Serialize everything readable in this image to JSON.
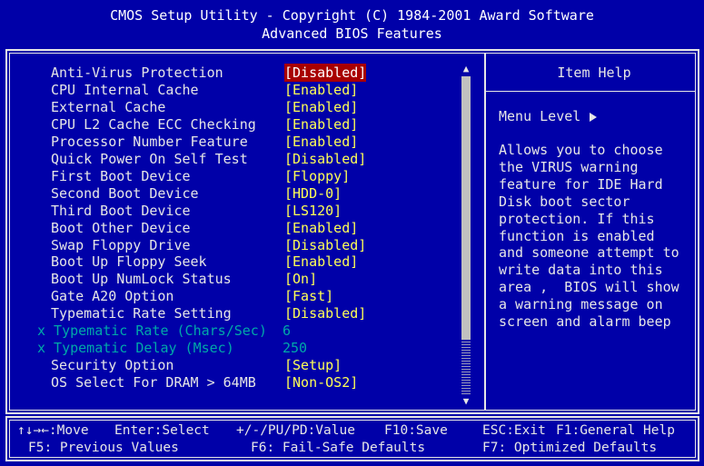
{
  "header": {
    "line1": "CMOS Setup Utility - Copyright (C) 1984-2001 Award Software",
    "line2": "Advanced BIOS Features"
  },
  "settings": [
    {
      "label": "Anti-Virus Protection",
      "value": "[Disabled]",
      "selected": true,
      "disabled": false
    },
    {
      "label": "CPU Internal Cache",
      "value": "[Enabled]",
      "selected": false,
      "disabled": false
    },
    {
      "label": "External Cache",
      "value": "[Enabled]",
      "selected": false,
      "disabled": false
    },
    {
      "label": "CPU L2 Cache ECC Checking",
      "value": "[Enabled]",
      "selected": false,
      "disabled": false
    },
    {
      "label": "Processor Number Feature",
      "value": "[Enabled]",
      "selected": false,
      "disabled": false
    },
    {
      "label": "Quick Power On Self Test",
      "value": "[Disabled]",
      "selected": false,
      "disabled": false
    },
    {
      "label": "First Boot Device",
      "value": "[Floppy]",
      "selected": false,
      "disabled": false
    },
    {
      "label": "Second Boot Device",
      "value": "[HDD-0]",
      "selected": false,
      "disabled": false
    },
    {
      "label": "Third Boot Device",
      "value": "[LS120]",
      "selected": false,
      "disabled": false
    },
    {
      "label": "Boot Other Device",
      "value": "[Enabled]",
      "selected": false,
      "disabled": false
    },
    {
      "label": "Swap Floppy Drive",
      "value": "[Disabled]",
      "selected": false,
      "disabled": false
    },
    {
      "label": "Boot Up Floppy Seek",
      "value": "[Enabled]",
      "selected": false,
      "disabled": false
    },
    {
      "label": "Boot Up NumLock Status",
      "value": "[On]",
      "selected": false,
      "disabled": false
    },
    {
      "label": "Gate A20 Option",
      "value": "[Fast]",
      "selected": false,
      "disabled": false
    },
    {
      "label": "Typematic Rate Setting",
      "value": "[Disabled]",
      "selected": false,
      "disabled": false
    },
    {
      "label": "x Typematic Rate (Chars/Sec)",
      "value": "6",
      "selected": false,
      "disabled": true
    },
    {
      "label": "x Typematic Delay (Msec)",
      "value": "250",
      "selected": false,
      "disabled": true
    },
    {
      "label": "Security Option",
      "value": "[Setup]",
      "selected": false,
      "disabled": false
    },
    {
      "label": "OS Select For DRAM > 64MB",
      "value": "[Non-OS2]",
      "selected": false,
      "disabled": false
    }
  ],
  "help": {
    "title": "Item Help",
    "menu_level": "Menu Level",
    "lines": [
      "Allows you to choose",
      "the VIRUS warning",
      "feature for IDE Hard",
      "Disk boot sector",
      "protection. If this",
      "function is enabled",
      "and someone attempt to",
      "write data into this",
      "area ,  BIOS will show",
      "a warning message on",
      "screen and alarm beep"
    ]
  },
  "footer": {
    "move": "↑↓→←:Move",
    "enter": "Enter:Select",
    "value": "+/-/PU/PD:Value",
    "save": "F10:Save",
    "exit": "ESC:Exit",
    "general_help": "F1:General Help",
    "f5": "F5: Previous Values",
    "f6": "F6: Fail-Safe Defaults",
    "f7": "F7: Optimized Defaults"
  },
  "colors": {
    "background": "#0000a8",
    "text": "#e6e6e6",
    "value": "#ffff55",
    "selected_bg": "#a80000",
    "disabled": "#00a8a8"
  }
}
